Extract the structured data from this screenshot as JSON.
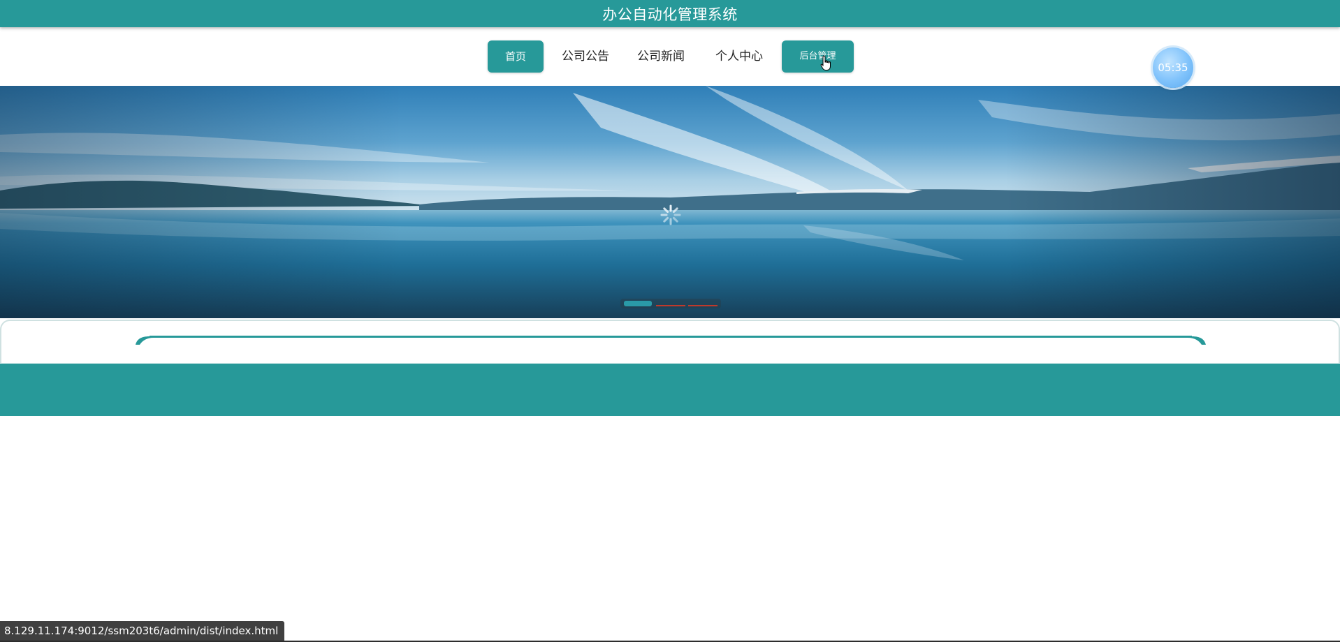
{
  "header": {
    "title": "办公自动化管理系统"
  },
  "nav": {
    "items": [
      {
        "label": "首页",
        "active": true
      },
      {
        "label": "公司公告",
        "active": false
      },
      {
        "label": "公司新闻",
        "active": false
      },
      {
        "label": "个人中心",
        "active": false
      },
      {
        "label": "后台管理",
        "active": false
      }
    ]
  },
  "clock": {
    "time": "05:35"
  },
  "banner": {
    "icon": "loading-spinner-icon",
    "slide_count": 3,
    "active_slide": 1
  },
  "status_bar": {
    "url": "8.129.11.174:9012/ssm203t6/admin/dist/index.html"
  },
  "colors": {
    "accent": "#279999",
    "clock": "#7fc2fb",
    "status_bg": "#404040",
    "dot_inactive": "#c0392b"
  }
}
